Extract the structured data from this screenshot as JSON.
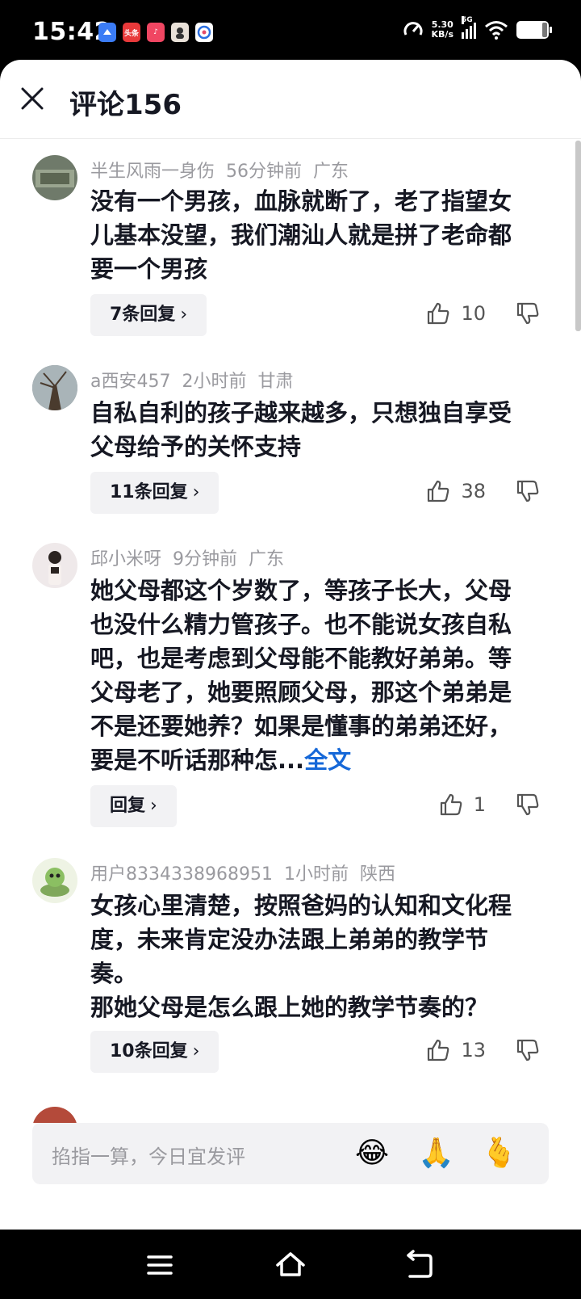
{
  "status_bar": {
    "time": "15:42",
    "app_icons": [
      {
        "name": "app-icon-blue",
        "color": "#3b7cf5",
        "text": ""
      },
      {
        "name": "app-icon-toutiao",
        "color": "#e8393a",
        "text": "头条"
      },
      {
        "name": "app-icon-tiktok",
        "color": "#f04662",
        "text": "♪"
      },
      {
        "name": "app-icon-avatar",
        "color": "#e9e1d8",
        "text": ""
      },
      {
        "name": "app-icon-map",
        "color": "#e44b6a",
        "text": ""
      }
    ],
    "net_speed_value": "5.30",
    "net_speed_unit": "KB/s",
    "network": "5G"
  },
  "header": {
    "title": "评论156"
  },
  "comments": [
    {
      "user": "半生风雨一身伤",
      "time": "56分钟前",
      "location": "广东",
      "text": "没有一个男孩，血脉就断了，老了指望女儿基本没望，我们潮汕人就是拼了老命都要一个男孩",
      "more": "",
      "reply_label": "7条回复",
      "likes": "10",
      "avatar_color": "#6f7a6a"
    },
    {
      "user": "a西安457",
      "time": "2小时前",
      "location": "甘肃",
      "text": "自私自利的孩子越来越多，只想独自享受父母给予的关怀支持",
      "more": "",
      "reply_label": "11条回复",
      "likes": "38",
      "avatar_color": "#7e8a92"
    },
    {
      "user": "邱小米呀",
      "time": "9分钟前",
      "location": "广东",
      "text": "她父母都这个岁数了，等孩子长大，父母也没什么精力管孩子。也不能说女孩自私吧，也是考虑到父母能不能教好弟弟。等父母老了，她要照顾父母，那这个弟弟是不是还要她养？如果是懂事的弟弟还好，要是不听话那种怎...",
      "more": "全文",
      "reply_label": "回复",
      "likes": "1",
      "avatar_color": "#efe9ea"
    },
    {
      "user": "用户8334338968951",
      "time": "1小时前",
      "location": "陕西",
      "text": "女孩心里清楚，按照爸妈的认知和文化程度，未来肯定没办法跟上弟弟的教学节奏。\n那她父母是怎么跟上她的教学节奏的？",
      "more": "",
      "reply_label": "10条回复",
      "likes": "13",
      "avatar_color": "#dfe8d2"
    }
  ],
  "input": {
    "placeholder": "掐指一算，今日宜发评",
    "emojis": [
      "😂",
      "🙏",
      "🫰"
    ]
  }
}
